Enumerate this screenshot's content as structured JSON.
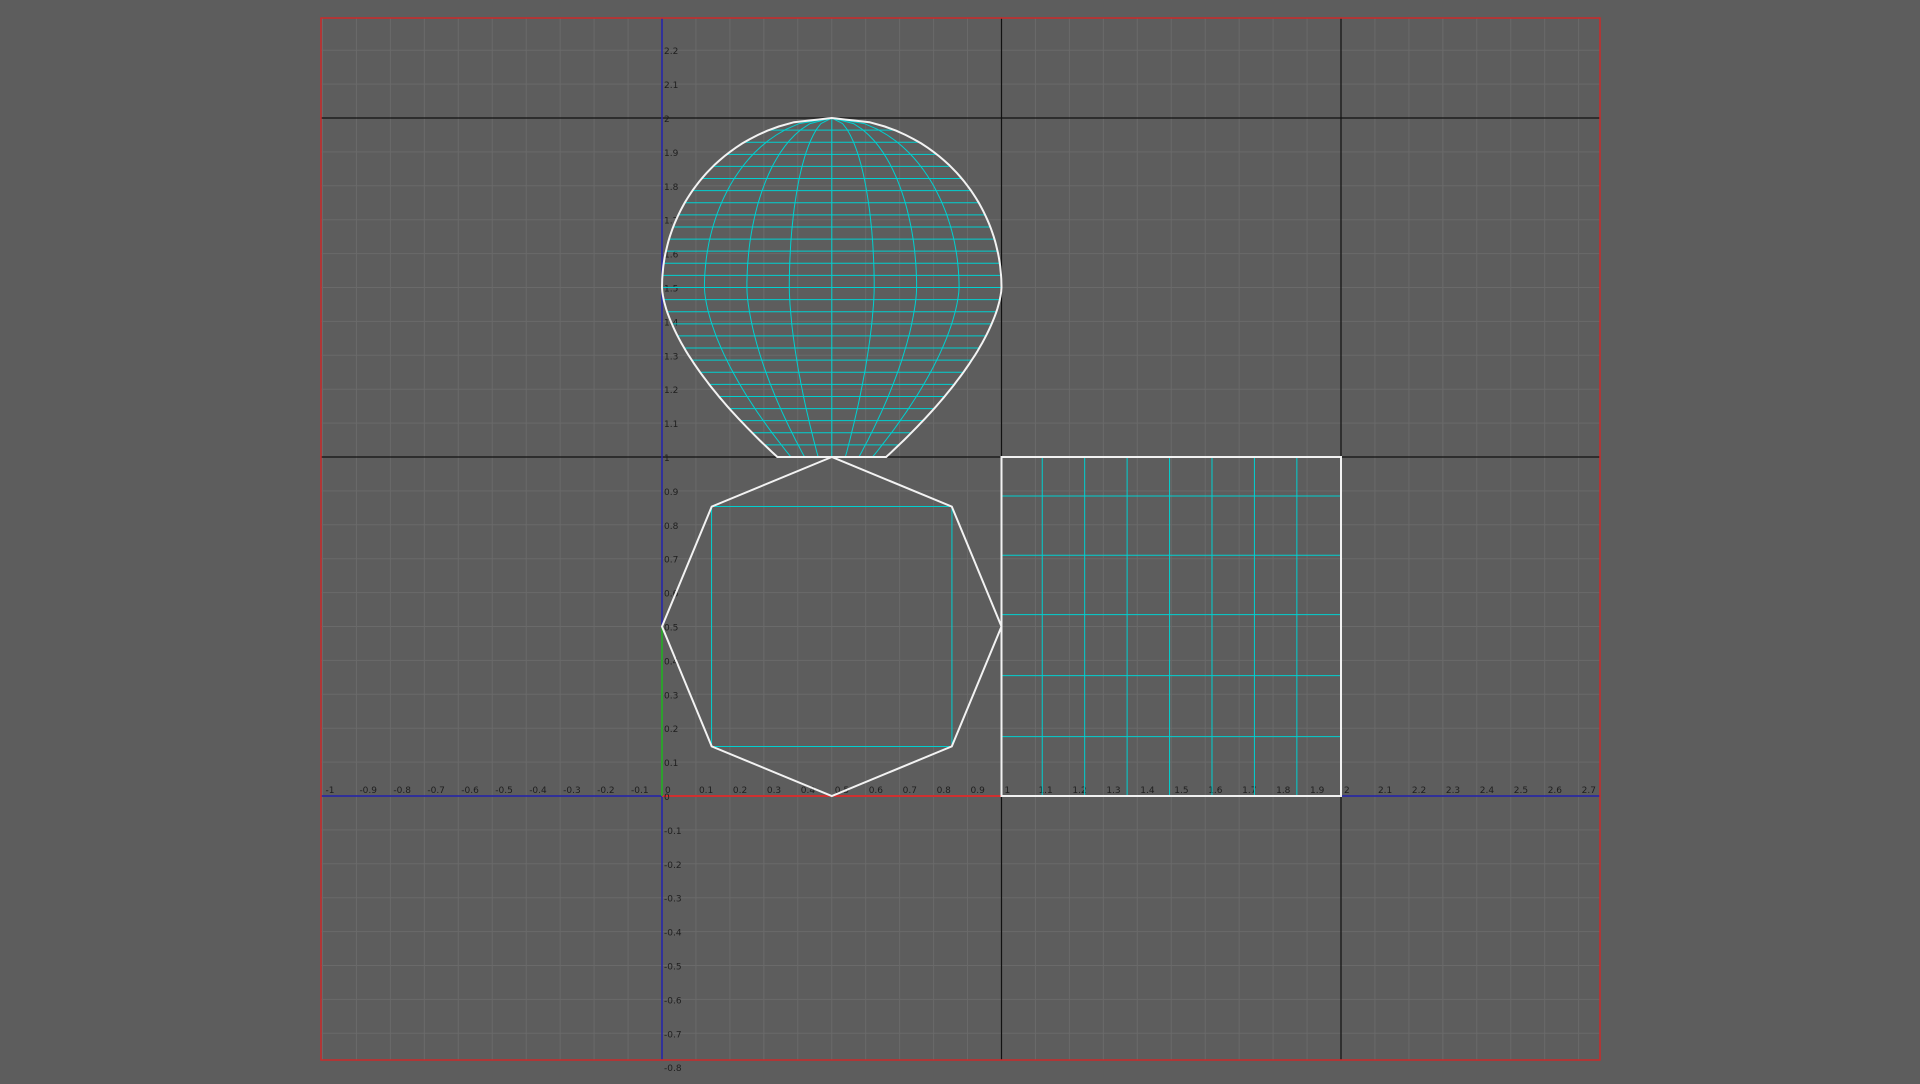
{
  "view": {
    "x_min": -1.0,
    "x_max": 2.75,
    "y_min": -0.8,
    "y_max": 2.3,
    "x_tick_labels": [
      "-1",
      "-0.9",
      "-0.8",
      "-0.7",
      "-0.6",
      "-0.5",
      "-0.4",
      "-0.3",
      "-0.2",
      "-0.1",
      "0",
      "0.1",
      "0.2",
      "0.3",
      "0.4",
      "0.5",
      "0.6",
      "0.7",
      "0.8",
      "0.9",
      "1",
      "1.1",
      "1.2",
      "1.3",
      "1.4",
      "1.5",
      "1.6",
      "1.7",
      "1.8",
      "1.9",
      "2",
      "2.1",
      "2.2",
      "2.3",
      "2.4",
      "2.5",
      "2.6",
      "2.7"
    ],
    "y_tick_labels": [
      "-0.8",
      "-0.7",
      "-0.6",
      "-0.5",
      "-0.4",
      "-0.3",
      "-0.2",
      "-0.1",
      "0",
      "0.1",
      "0.2",
      "0.3",
      "0.4",
      "0.5",
      "0.6",
      "0.7",
      "0.8",
      "0.9",
      "1",
      "1.1",
      "1.2",
      "1.3",
      "1.4",
      "1.5",
      "1.6",
      "1.7",
      "1.8",
      "1.9",
      "2",
      "2.1",
      "2.2"
    ],
    "uv_tile_lines_u": [
      0,
      1,
      2
    ],
    "uv_tile_lines_v": [
      0,
      1,
      2
    ],
    "grid_step": 0.1
  },
  "colors": {
    "background": "#5d5d5d",
    "grid_minor": "#6a6a6a",
    "tile_border": "#111111",
    "frame_border": "#cc2a2a",
    "u_axis": "#d03030",
    "v_axis": "#2828b4",
    "u_axis_right": "#2828b4",
    "v_axis_origin": "#2ea02e",
    "uv_edge": "#00d0d0",
    "uv_border": "#f2f2f2",
    "tick_label": "#1e1e1e"
  },
  "shells": {
    "sphere": {
      "u_min": 0.0,
      "u_max": 1.0,
      "v_min": 1.0,
      "v_max": 2.0,
      "meridians": 7,
      "latitude_rows": 28
    },
    "cap_octagon": {
      "center": [
        0.5,
        0.5
      ],
      "radius": 0.5,
      "sides": 8,
      "inner_square": [
        [
          0.146,
          0.146
        ],
        [
          0.854,
          0.854
        ]
      ]
    },
    "square_grid": {
      "u_min": 1.0,
      "u_max": 2.0,
      "v_min": 0.0,
      "v_max": 1.0,
      "u_cuts": [
        1.12,
        1.245,
        1.37,
        1.495,
        1.62,
        1.745,
        1.87
      ],
      "v_cuts": [
        0.175,
        0.355,
        0.535,
        0.71,
        0.885
      ]
    }
  }
}
